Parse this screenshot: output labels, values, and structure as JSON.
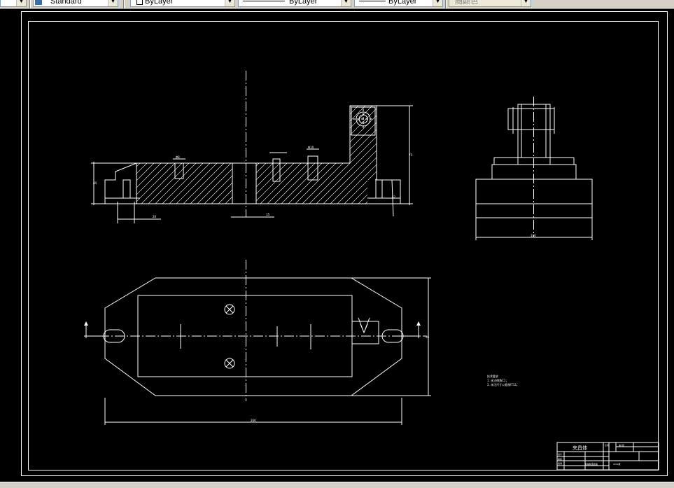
{
  "toolbar": {
    "text_style": "Standard",
    "layer_color": "ByLayer",
    "linetype": "ByLayer",
    "lineweight": "ByLayer",
    "plot_style": "随颜色"
  },
  "drawing": {
    "title_block": {
      "part_name": "夹具体",
      "scale_label": "比例",
      "sheet_label": "第1张",
      "designer_row": "设计",
      "checker_row": "审核",
      "approve_row": "批准",
      "school": "机械制造装备",
      "class_code": "2012级"
    },
    "tech_notes": {
      "heading": "技术要求",
      "line1": "1. 未注倒角C1；",
      "line2": "2. 未注尺寸公差按IT12。"
    },
    "dim_labels": {
      "height_left": "44",
      "height_right": "75",
      "height_mid": "62",
      "bottom_small": "20",
      "bottom_mid": "15",
      "top_hole": "Φ8",
      "top_hole2": "Φ10",
      "side_width": "100",
      "plan_width": "260",
      "plan_height": "96"
    }
  }
}
